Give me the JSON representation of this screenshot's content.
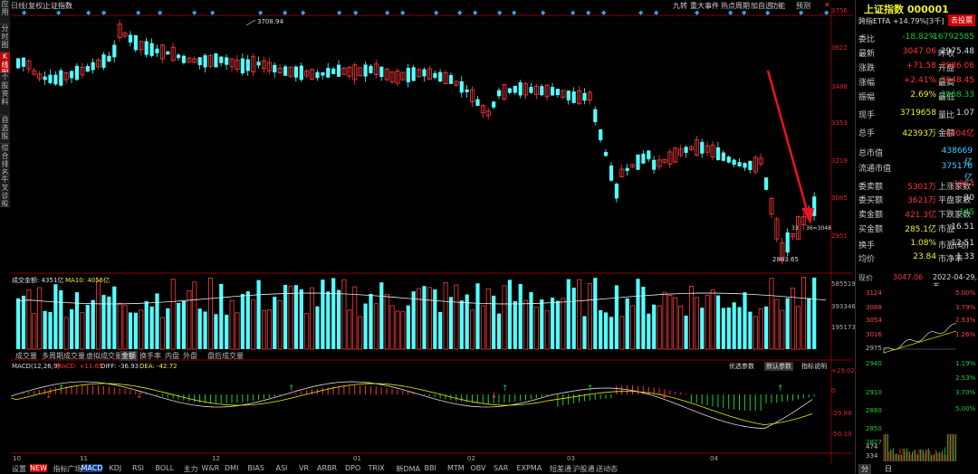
{
  "left_tabs": [
    "应用",
    "分时图",
    "K线图",
    "个股资料",
    "自选股",
    "综合排名",
    "牛叉诊股"
  ],
  "left_tab_selected": 2,
  "title_bar": {
    "period": "日线(复权)",
    "name": "上证指数"
  },
  "top_buttons": [
    "九转",
    "重大事件",
    "热点周期",
    "加自选",
    "功能",
    "预测"
  ],
  "price_axis": [
    "3756",
    "3622",
    "3488",
    "3353",
    "3219",
    "3085",
    "2951"
  ],
  "annotations": {
    "high": "3708.94",
    "low": "2863.65",
    "last_short": "33",
    "tip": "36=3048"
  },
  "volume": {
    "title": "成交金额: 4351亿",
    "ma10": "MA10: 4056亿",
    "axis": [
      "585519",
      "393346",
      "195173"
    ]
  },
  "vol_tabs": [
    "成交量",
    "多周期成交量",
    "虚拟成交量",
    "金额",
    "换手率",
    "内盘",
    "外盘",
    "盘后成交量"
  ],
  "vol_tab_selected": 3,
  "macd": {
    "header": "MACD(12,26,9)",
    "macd_val": "MACD: +11.65",
    "diff": "DIFF: -36.93",
    "dea": "DEA: -42.72",
    "axis": [
      "+29.02",
      "0",
      "-29.88",
      "-50.19"
    ]
  },
  "param_buttons": [
    "优选参数",
    "默认参数",
    "指标说明"
  ],
  "x_months": [
    "10",
    "11",
    "12",
    "01",
    "02",
    "03",
    "04"
  ],
  "bottom_tabs": [
    "设置",
    "NEW",
    "指标广场",
    "MACD",
    "KDJ",
    "RSI",
    "BOLL",
    "主力",
    "W&R",
    "DMI",
    "BIAS",
    "ASI",
    "VR",
    "ARBR",
    "DPO",
    "TRIX",
    "新DMA",
    "BBI",
    "MTM",
    "OBV",
    "SAR",
    "EXPMA",
    "短差通",
    "沪股通",
    "送动态"
  ],
  "bottom_selected": 3,
  "right_panel": {
    "title": "上证指数 000001",
    "etf": "跨指ETFA +14.79%[3千]",
    "ad_label": "去投票",
    "rows": [
      {
        "l": "委比",
        "v": "-18.82%",
        "l2": "",
        "v2": "-16792585"
      },
      {
        "l": "最新",
        "v": "3047.06",
        "l2": "昨收",
        "v2": "2975.48"
      },
      {
        "l": "涨跌",
        "v": "+71.58",
        "l2": "开盘",
        "v2": "2986.06"
      },
      {
        "l": "涨幅",
        "v": "+2.41%",
        "l2": "最高",
        "v2": "3048.45"
      },
      {
        "l": "振幅",
        "v": "2.69%",
        "l2": "最低",
        "v2": "2968.33"
      },
      {
        "l": "现手",
        "v": "3719658",
        "l2": "量比",
        "v2": "1.07"
      },
      {
        "l": "总手",
        "v": "42393万",
        "l2": "金额",
        "v2": "4404亿"
      },
      {
        "l": "总市值",
        "v": "438669亿",
        "l2": "",
        "v2": ""
      },
      {
        "l": "流通市值",
        "v": "375176亿",
        "l2": "",
        "v2": ""
      },
      {
        "l": "委卖额",
        "v": "5301万",
        "l2": "上涨家数",
        "v2": "1954"
      },
      {
        "l": "委买额",
        "v": "3621万",
        "l2": "平盘家数",
        "v2": "30"
      },
      {
        "l": "卖金额",
        "v": "421.3亿",
        "l2": "下跌家数",
        "v2": "145"
      },
      {
        "l": "买金额",
        "v": "285.1亿",
        "l2": "市盈",
        "v2": "16.51"
      },
      {
        "l": "换手",
        "v": "1.08%",
        "l2": "市盈(动)",
        "v2": "12.51"
      },
      {
        "l": "均价",
        "v": "23.84",
        "l2": "市净率",
        "v2": "1.33"
      }
    ],
    "date_row": {
      "label": "现价",
      "price": "3047.06",
      "date": "2022-04-29,五"
    },
    "mini_left_axis": [
      "3124",
      "3088",
      "3054",
      "3016",
      "2975",
      "2940",
      "2910",
      "2880",
      "2850",
      "2827",
      "474",
      "334"
    ],
    "mini_right_axis": [
      "5.00%",
      "3.79%",
      "2.53%",
      "1.26%",
      "1.19%",
      "2.53%",
      "3.70%",
      "5.00%"
    ],
    "mini_tabs": [
      "分",
      "日"
    ]
  }
}
